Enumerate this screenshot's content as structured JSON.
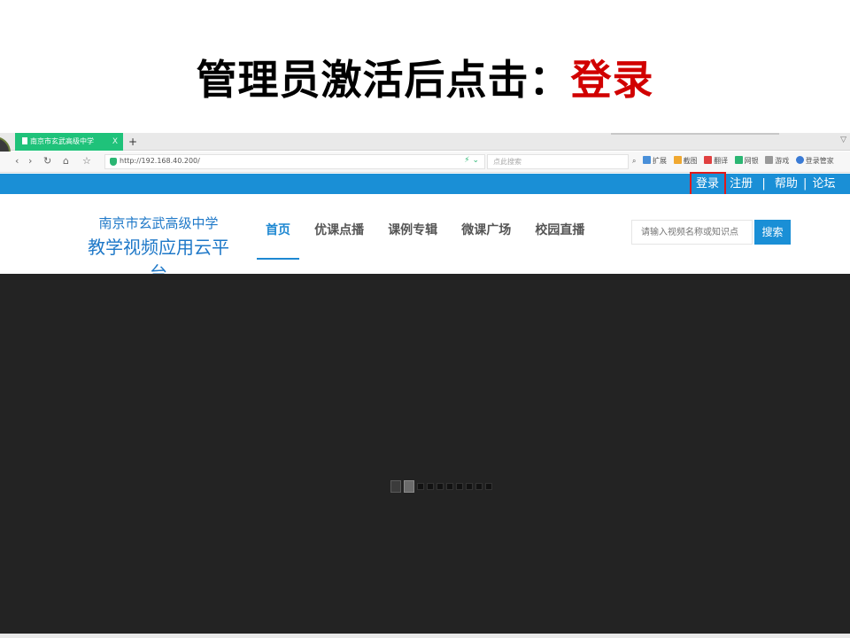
{
  "slide": {
    "title_prefix": "管理员激活后点击：",
    "title_highlight": "登录"
  },
  "browser": {
    "tab_title": "南京市玄武高级中学",
    "tab_close": "X",
    "new_tab": "+",
    "url": "http://192.168.40.200/",
    "search_placeholder": "点此搜索",
    "toolbar": {
      "extensions": "扩展",
      "screenshot": "截图",
      "translate": "翻译",
      "netbank": "网银",
      "games": "游戏",
      "login_manager": "登录管家"
    }
  },
  "site": {
    "topbar": {
      "login": "登录",
      "register": "注册",
      "sep1": "|",
      "help": "帮助",
      "sep2": "|",
      "forum": "论坛"
    },
    "logo_line1": "南京市玄武高级中学",
    "logo_line2": "教学视频应用云平台",
    "nav": [
      "首页",
      "优课点播",
      "课例专辑",
      "微课广场",
      "校园直播"
    ],
    "search_placeholder": "请输入视频名称或知识点",
    "search_button": "搜索"
  },
  "carousel": {
    "total_dots": 10,
    "active_index": 1
  },
  "colors": {
    "site_blue": "#1a8fd6",
    "highlight_red": "#e01a1a",
    "tab_green": "#1fc27a"
  }
}
